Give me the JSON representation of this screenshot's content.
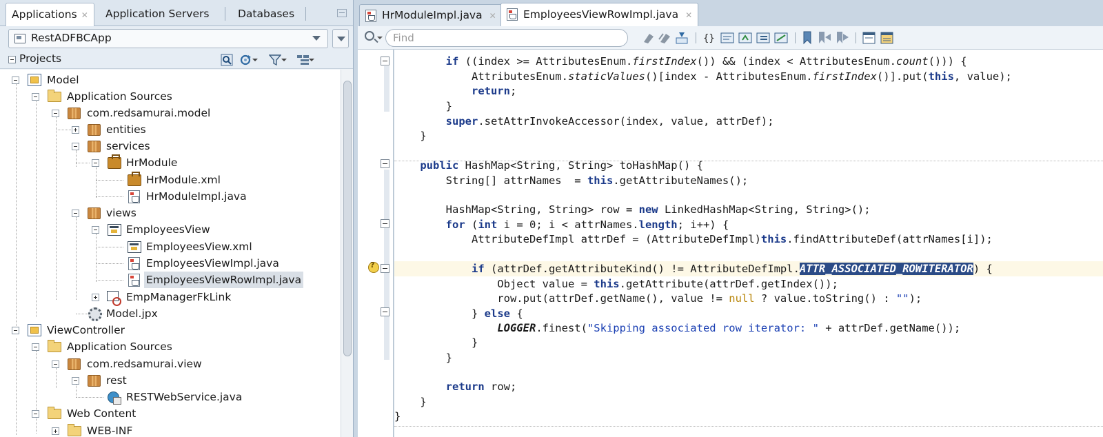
{
  "left_tabs": [
    {
      "label": "Applications",
      "active": true
    },
    {
      "label": "Application Servers",
      "active": false
    },
    {
      "label": "Databases",
      "active": false
    }
  ],
  "app_selector": {
    "value": "RestADFBCApp"
  },
  "projects_panel": {
    "title": "Projects"
  },
  "tree": [
    {
      "label": "Model",
      "icon": "project-icon"
    },
    {
      "label": "Application Sources",
      "icon": "folder-icon"
    },
    {
      "label": "com.redsamurai.model",
      "icon": "package-icon"
    },
    {
      "label": "entities",
      "icon": "package-icon"
    },
    {
      "label": "services",
      "icon": "package-icon"
    },
    {
      "label": "HrModule",
      "icon": "app-module-icon"
    },
    {
      "label": "HrModule.xml",
      "icon": "app-module-icon"
    },
    {
      "label": "HrModuleImpl.java",
      "icon": "java-file-icon"
    },
    {
      "label": "views",
      "icon": "package-icon"
    },
    {
      "label": "EmployeesView",
      "icon": "view-object-icon"
    },
    {
      "label": "EmployeesView.xml",
      "icon": "view-object-icon"
    },
    {
      "label": "EmployeesViewImpl.java",
      "icon": "java-file-icon"
    },
    {
      "label": "EmployeesViewRowImpl.java",
      "icon": "java-file-icon"
    },
    {
      "label": "EmpManagerFkLink",
      "icon": "view-link-icon"
    },
    {
      "label": "Model.jpx",
      "icon": "project-settings-icon"
    },
    {
      "label": "ViewController",
      "icon": "project-icon"
    },
    {
      "label": "Application Sources",
      "icon": "folder-icon"
    },
    {
      "label": "com.redsamurai.view",
      "icon": "package-icon"
    },
    {
      "label": "rest",
      "icon": "package-icon"
    },
    {
      "label": "RESTWebService.java",
      "icon": "web-service-icon"
    },
    {
      "label": "Web Content",
      "icon": "folder-icon"
    },
    {
      "label": "WEB-INF",
      "icon": "folder-icon"
    }
  ],
  "editor_tabs": [
    {
      "label": "HrModuleImpl.java",
      "active": false
    },
    {
      "label": "EmployeesViewRowImpl.java",
      "active": true
    }
  ],
  "find": {
    "placeholder": "Find"
  },
  "code_lines": [
    "        if ((index >= AttributesEnum.firstIndex()) && (index < AttributesEnum.count())) {",
    "            AttributesEnum.staticValues()[index - AttributesEnum.firstIndex()].put(this, value);",
    "            return;",
    "        }",
    "        super.setAttrInvokeAccessor(index, value, attrDef);",
    "    }",
    "",
    "    public HashMap<String, String> toHashMap() {",
    "        String[] attrNames  = this.getAttributeNames();",
    "",
    "        HashMap<String, String> row = new LinkedHashMap<String, String>();",
    "        for (int i = 0; i < attrNames.length; i++) {",
    "            AttributeDefImpl attrDef = (AttributeDefImpl)this.findAttributeDef(attrNames[i]);",
    "",
    "            if (attrDef.getAttributeKind() != AttributeDefImpl.ATTR_ASSOCIATED_ROWITERATOR) {",
    "                Object value = this.getAttribute(attrDef.getIndex());",
    "                row.put(attrDef.getName(), value != null ? value.toString() : \"\");",
    "            } else {",
    "                LOGGER.finest(\"Skipping associated row iterator: \" + attrDef.getName());",
    "            }",
    "        }",
    "",
    "        return row;",
    "    }",
    "}"
  ]
}
